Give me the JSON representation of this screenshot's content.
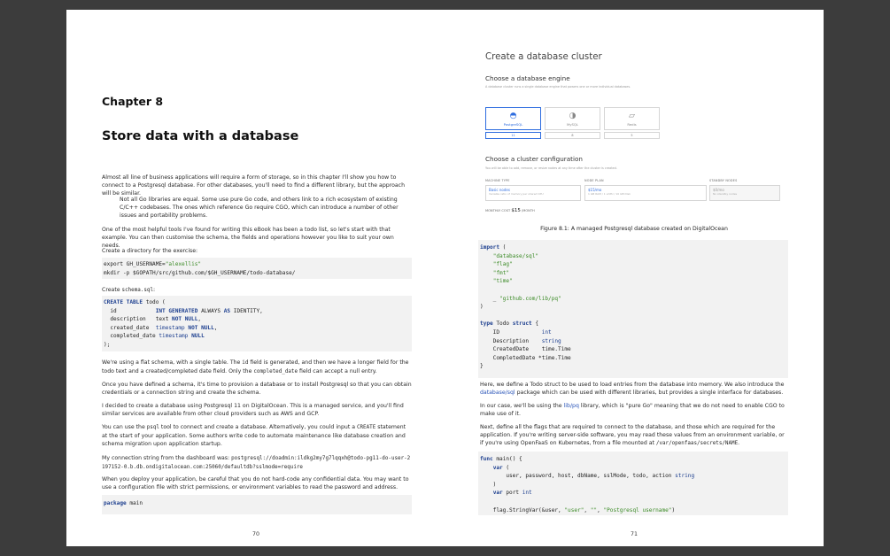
{
  "left_page": {
    "chapter": "Chapter 8",
    "title": "Store data with a database",
    "p1": "Almost all line of business applications will require a form of storage, so in this chapter I'll show you how to connect to a Postgresql database. For other databases, you'll need to find a different library, but the approach will be similar.",
    "note": "Not all Go libraries are equal. Some use pure Go code, and others link to a rich ecosystem of existing C/C++ codebases. The ones which reference Go require CGO, which can introduce a number of other issues and portability problems.",
    "p2": "One of the most helpful tools I've found for writing this eBook has been a todo list, so let's start with that example. You can then customise the schema, the fields and operations however you like to suit your own needs.",
    "p3": "Create a directory for the exercise:",
    "code1": [
      "export GH_USERNAME=\"alexellis\"",
      "mkdir -p $GOPATH/src/github.com/$GH_USERNAME/todo-database/"
    ],
    "p4_prefix": "Create ",
    "p4_code": "schema.sql",
    "p4_suffix": ":",
    "p5_a": "We're using a flat schema, with a single table. The ",
    "p5_id": "id",
    "p5_b": " field is generated, and then we have a longer field for the todo text and a created/completed date field. Only the ",
    "p5_cd": "completed_date",
    "p5_c": " field can accept a null entry.",
    "p6": "Once you have defined a schema, it's time to provision a database or to install Postgresql so that you can obtain credentials or a connection string and create the schema.",
    "p7": "I decided to create a database using Postgresql 11 on DigitalOcean. This is a managed service, and you'll find similar services are available from other cloud providers such as AWS and GCP.",
    "p8_a": "You can use the ",
    "p8_psql": "psql",
    "p8_b": " tool to connect and create a database. Alternatively, you could input a ",
    "p8_create": "CREATE",
    "p8_c": " statement at the start of your application. Some authors write code to automate maintenance like database creation and schema migration upon application startup.",
    "p9_a": "My connection string from the dashboard was: ",
    "p9_conn": "postgresql://doadmin:ildkg2my7g7lqqxh@todo-pg11-do-user-2197152-0.b.db.ondigitalocean.com:25060/defaultdb?sslmode=require",
    "p10": "When you deploy your application, be careful that you do not hard-code any confidential data. You may want to use a configuration file with strict permissions, or environment variables to read the password and address.",
    "code_package_kw": "package",
    "code_package_name": " main",
    "page_number": "70"
  },
  "right_page": {
    "screenshot": {
      "title": "Create a database cluster",
      "engine_heading": "Choose a database engine",
      "engine_sub": "A database cluster runs a single database engine that powers one or more individual databases.",
      "engines": [
        {
          "name": "PostgreSQL",
          "version": "11",
          "icon": "elephant-icon",
          "selected": true
        },
        {
          "name": "MySQL",
          "version": "8",
          "icon": "dolphin-icon",
          "selected": false
        },
        {
          "name": "Redis",
          "version": "5",
          "icon": "cube-icon",
          "selected": false
        }
      ],
      "config_heading": "Choose a cluster configuration",
      "config_sub": "You will be able to add, remove, or resize nodes at any time after the cluster is created.",
      "machine_label": "MACHINE TYPE",
      "machine_value": "Basic nodes",
      "machine_sub": "Variable ratio of memory per shared CPU",
      "plan_label": "NODE PLAN",
      "plan_value": "$15/mo",
      "plan_sub": "1 GB RAM / 1 vCPU / 10 GB Disk",
      "standby_label": "STANDBY NODES",
      "standby_value": "$0/mo",
      "standby_sub": "No standby nodes",
      "monthly_label": "MONTHLY COST",
      "monthly_value": "$15",
      "monthly_unit": "/MONTH"
    },
    "caption": "Figure 8.1: A managed Postgresql database created on DigitalOcean",
    "p1_a": "Here, we define a Todo struct to be used to load entries from the database into memory. We also introduce the ",
    "p1_link": "database/sql",
    "p1_b": " package which can be used with different libraries, but provides a single interface for databases.",
    "p2_a": "In our case, we'll be using the ",
    "p2_link": "lib/pq",
    "p2_b": " library, which is \"pure Go\" meaning that we do not need to enable CGO to make use of it.",
    "p3_a": "Next, define all the flags that are required to connect to the database, and those which are required for the application. If you're writing server-side software, you may read these values from an environment variable, or if you're using OpenFaaS on Kubernetes, from a file mounted at ",
    "p3_path": "/var/openfaas/secrets/NAME",
    "p3_b": ".",
    "page_number": "71"
  }
}
